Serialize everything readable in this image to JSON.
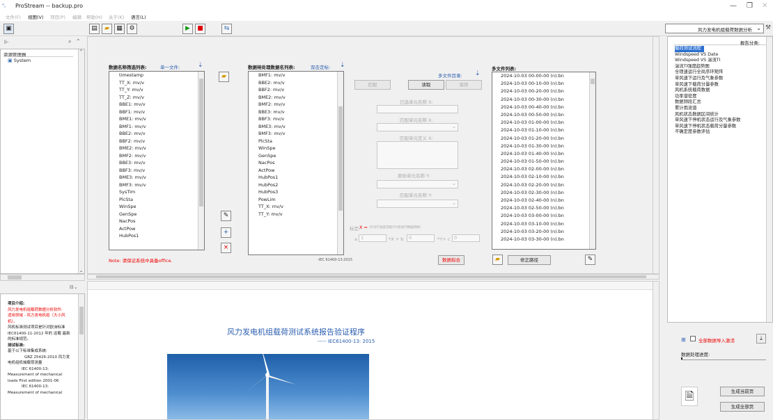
{
  "window": {
    "title": "ProStream -- backup.pro",
    "icon": "ᴬ꜀"
  },
  "menu": [
    "文件(F)",
    "视图(V)",
    "项目(P)",
    "编辑",
    "帮助(H)",
    "关于(K)",
    "语言(L)"
  ],
  "left": {
    "explorer_title": "资源管理器",
    "root_item": "System"
  },
  "info": {
    "heading": "项目介绍:",
    "lines_red": [
      "风力发电机组载荷数据分析软件:",
      "适用领域 - 风力发电机组（大小风",
      "机）。"
    ],
    "lines": [
      "风机标准测试项目是针对欧洲标准",
      "IEC61400-11-2012 年的 运载 最新",
      "的标准规范。"
    ],
    "std_heading": "测试标准:",
    "std_lines": [
      "基于以下标准集成系统:",
      "GBZ 25426-2010 风力发",
      "电机组机械载荷测量",
      "IEC 61400-13:",
      "Measurement of mechanical",
      "loads First edition 2001-06",
      "IEC 61400-13:",
      "Measurement of mechanical"
    ]
  },
  "form": {
    "list1_title": "数据名称筛选列表:",
    "list1_link": "单一文件:",
    "list1_items": [
      "timestamp",
      "TT_X:  mv/v",
      "TT_Y:  mv/v",
      "TT_Z:  mv/v",
      "BBE1:  mv/v",
      "BBF1:  mv/v",
      "BME1:  mv/v",
      "BMF1:  mv/v",
      "BBE2:  mv/v",
      "BBF2:  mv/v",
      "BME2:  mv/v",
      "BMF2:  mv/v",
      "BBE3:  mv/v",
      "BBF3:  mv/v",
      "BME3:  mv/v",
      "BMF3:  mv/v",
      "SysTim",
      "PlcSta",
      "WinSpe",
      "GenSpe",
      "NacPos",
      "ActPow",
      "HubPos1"
    ],
    "list2_title": "数据待处理数据名列表:",
    "list2_link": "双击定标:",
    "list2_items": [
      "BMF1:  mv/v",
      "BBE2:  mv/v",
      "BBF2:  mv/v",
      "BME2:  mv/v",
      "BMF2:  mv/v",
      "BBE3:  mv/v",
      "BBF3:  mv/v",
      "BME3:  mv/v",
      "BMF3:  mv/v",
      "PlcSta",
      "WinSpe",
      "GenSpe",
      "NacPos",
      "ActPow",
      "HubPos1",
      "HubPos2",
      "HubPos3",
      "PowLim",
      "TT_X:  mv/v",
      "TT_Y:  mv/v"
    ],
    "list3_title": "多文件列表:",
    "list3_link": "多文件目录:",
    "list3_items": [
      "2024-10-03 00-00-00 (n).bn",
      "2024-10-03 00-10-00 (n).bn",
      "2024-10-03 00-20-00 (n).bn",
      "2024-10-03 00-30-00 (n).bn",
      "2024-10-03 00-40-00 (n).bn",
      "2024-10-03 00-50-00 (n).bn",
      "2024-10-03 01-00-00 (n).bn",
      "2024-10-03 01-10-00 (n).bn",
      "2024-10-03 01-20-00 (n).bn",
      "2024-10-03 01-30-00 (n).bn",
      "2024-10-03 01-40-00 (n).bn",
      "2024-10-03 01-50-00 (n).bn",
      "2024-10-03 02-00-00 (n).bn",
      "2024-10-03 02-10-00 (n).bn",
      "2024-10-03 02-20-00 (n).bn",
      "2024-10-03 02-30-00 (n).bn",
      "2024-10-03 02-40-00 (n).bn",
      "2024-10-03 02-50-00 (n).bn",
      "2024-10-03 03-00-00 (n).bn",
      "2024-10-03 03-10-00 (n).bn",
      "2024-10-03 03-20-00 (n).bn",
      "2024-10-03 03-30-00 (n).bn"
    ],
    "match_btn": "匹配",
    "read_btn": "读取",
    "save_btn": "保存",
    "sel_x": "已选单元名称 X:",
    "match_x": "匹配单元名称 X:",
    "match_def_x": "匹配单元定义 X:",
    "src_y": "原始单元名称 Y:",
    "match_y": "匹配单元名称 Y:",
    "calib_label": "标定:",
    "calib_x": "X =",
    "calib_note": "(针对行角度须能行X值进行数据转换)",
    "a_label": "a",
    "a_val": "1",
    "b_label": "*X + b",
    "b_val": "0",
    "c_label": "*Y+ c",
    "c_val": "0",
    "note": "Note: 请保证系统中具备office.",
    "iec_note": "-IEC 61400-13:2015",
    "fit_btn": "数据拟合",
    "fix_btn": "修正路径"
  },
  "report": {
    "title": "风力发电机组载荷测试系统报告验证程序",
    "subtitle": "-----   IEC61400-13: 2015"
  },
  "right": {
    "dropdown": "风力发电机组载荷数据分析",
    "report_cat": "报告分类:",
    "items": [
      "载荷测试流程",
      "Windspeed VS Date",
      "Windspeed VS 湍流TI",
      "湍流TI强度趋势图",
      "全理速运行全局序环矩阵",
      "单风速下运行及气象参数",
      "单风速下载荷分量参数",
      "风机系统载荷数据",
      "功率谱密度",
      "数据频段汇总",
      "累计雨流谱",
      "风机状态数据区间统计",
      "单风速下停机状态运行及气象参数",
      "单风速下停机状态载荷分量参数",
      "不确定度参数评估"
    ],
    "import_all": "全部数据导入激活",
    "progress_label": "数据处理进度:",
    "progress": 0.02,
    "gen_cur": "生成当前页",
    "gen_all": "生成全部页"
  }
}
